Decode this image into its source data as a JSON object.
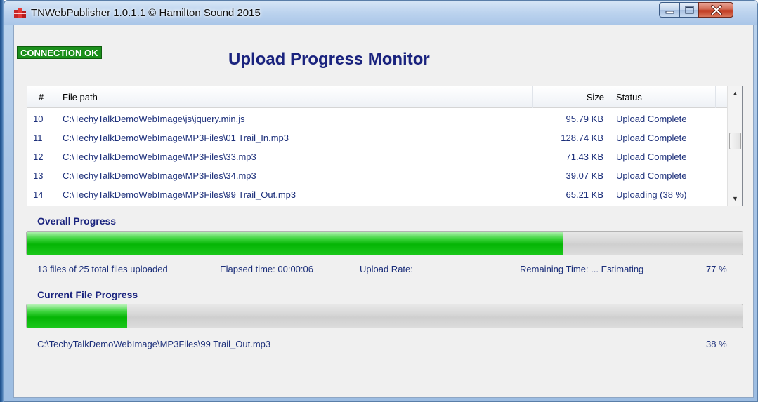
{
  "window": {
    "title": "TNWebPublisher 1.0.1.1  © Hamilton Sound 2015"
  },
  "connection_status": "CONNECTION OK",
  "page_title": "Upload Progress Monitor",
  "file_list": {
    "columns": [
      "#",
      "File path",
      "Size",
      "Status"
    ],
    "rows": [
      {
        "num": "10",
        "path": "C:\\TechyTalkDemoWebImage\\js\\jquery.min.js",
        "size": "95.79 KB",
        "status": "Upload Complete"
      },
      {
        "num": "11",
        "path": "C:\\TechyTalkDemoWebImage\\MP3Files\\01 Trail_In.mp3",
        "size": "128.74 KB",
        "status": "Upload Complete"
      },
      {
        "num": "12",
        "path": "C:\\TechyTalkDemoWebImage\\MP3Files\\33.mp3",
        "size": "71.43 KB",
        "status": "Upload Complete"
      },
      {
        "num": "13",
        "path": "C:\\TechyTalkDemoWebImage\\MP3Files\\34.mp3",
        "size": "39.07 KB",
        "status": "Upload Complete"
      },
      {
        "num": "14",
        "path": "C:\\TechyTalkDemoWebImage\\MP3Files\\99 Trail_Out.mp3",
        "size": "65.21 KB",
        "status": "Uploading (38 %)"
      }
    ]
  },
  "overall": {
    "label": "Overall Progress",
    "progress": 0.75,
    "files_text": "13 files of 25 total files uploaded",
    "elapsed_text": "Elapsed time: 00:00:06",
    "rate_text": "Upload Rate:",
    "remaining_text": "Remaining Time: ... Estimating",
    "percent_text": "77 %"
  },
  "current": {
    "label": "Current File Progress",
    "progress": 0.14,
    "path": "C:\\TechyTalkDemoWebImage\\MP3Files\\99 Trail_Out.mp3",
    "percent_text": "38 %"
  },
  "icons": {
    "app": "app-logo-icon",
    "minimize": "minimize-icon",
    "maximize": "maximize-icon",
    "close": "close-icon",
    "scroll_up": "scroll-up-icon",
    "scroll_down": "scroll-down-icon"
  },
  "colors": {
    "connection_badge": "#1c8f1c",
    "title": "#1a237e",
    "progress_fill": "#05b505",
    "text": "#1c2f7a"
  }
}
